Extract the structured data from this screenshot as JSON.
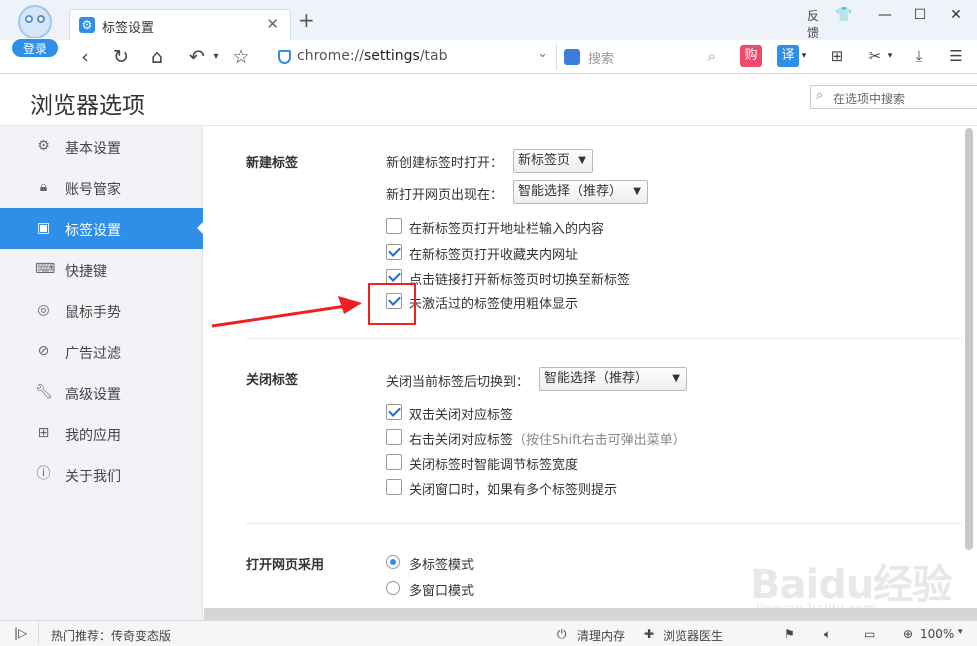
{
  "browser": {
    "login_label": "登录",
    "tab_title": "标签设置",
    "tab_close": "✕",
    "new_tab": "+",
    "feedback": "反馈",
    "url_prefix": "chrome://",
    "url_main": "settings",
    "url_suffix": "/tab",
    "search_placeholder": "搜索",
    "buy_label": "购",
    "translate_label": "译",
    "accent_color": "#2f8fe8"
  },
  "page": {
    "title": "浏览器选项",
    "options_search_placeholder": "在选项中搜索"
  },
  "sidebar": {
    "items": [
      {
        "label": "基本设置",
        "icon": "gear-icon",
        "active": false
      },
      {
        "label": "账号管家",
        "icon": "lock-icon",
        "active": false
      },
      {
        "label": "标签设置",
        "icon": "tabs-icon",
        "active": true
      },
      {
        "label": "快捷键",
        "icon": "keyboard-icon",
        "active": false
      },
      {
        "label": "鼠标手势",
        "icon": "mouse-icon",
        "active": false
      },
      {
        "label": "广告过滤",
        "icon": "block-icon",
        "active": false
      },
      {
        "label": "高级设置",
        "icon": "wrench-icon",
        "active": false
      },
      {
        "label": "我的应用",
        "icon": "apps-icon",
        "active": false
      },
      {
        "label": "关于我们",
        "icon": "info-icon",
        "active": false
      }
    ]
  },
  "new_tab_section": {
    "label": "新建标签",
    "open_new_label": "新创建标签时打开：",
    "open_new_value": "新标签页",
    "position_label": "新打开网页出现在：",
    "position_value": "智能选择（推荐）",
    "options": [
      {
        "label": "在新标签页打开地址栏输入的内容",
        "checked": false
      },
      {
        "label": "在新标签页打开收藏夹内网址",
        "checked": true
      },
      {
        "label": "点击链接打开新标签页时切换至新标签",
        "checked": true
      },
      {
        "label": "未激活过的标签使用粗体显示",
        "checked": true
      }
    ]
  },
  "close_tab_section": {
    "label": "关闭标签",
    "switch_label": "关闭当前标签后切换到：",
    "switch_value": "智能选择（推荐）",
    "options": [
      {
        "label": "双击关闭对应标签",
        "checked": true,
        "hint": ""
      },
      {
        "label": "右击关闭对应标签",
        "checked": false,
        "hint": "（按住Shift右击可弹出菜单）"
      },
      {
        "label": "关闭标签时智能调节标签宽度",
        "checked": false,
        "hint": ""
      },
      {
        "label": "关闭窗口时，如果有多个标签则提示",
        "checked": false,
        "hint": ""
      }
    ]
  },
  "open_page_section": {
    "label": "打开网页采用",
    "options": [
      {
        "label": "多标签模式",
        "selected": true
      },
      {
        "label": "多窗口模式",
        "selected": false
      }
    ]
  },
  "watermark": {
    "big": "Baidu经验",
    "small": "jingyan.baidu.com"
  },
  "statusbar": {
    "hot": "热门推荐：传奇变态版",
    "clean": "清理内存",
    "doctor": "浏览器医生",
    "zoom": "100%"
  }
}
